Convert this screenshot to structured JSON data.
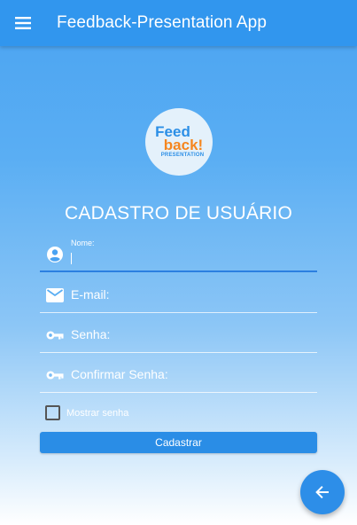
{
  "app_bar": {
    "title": "Feedback-Presentation App",
    "menu_icon": "hamburger-menu-icon"
  },
  "logo": {
    "line1": "Feed",
    "line2": "back!",
    "line3": "PRESENTATION"
  },
  "form": {
    "title": "CADASTRO DE USUÁRIO",
    "fields": [
      {
        "label": "Nome:",
        "icon": "account-circle-icon",
        "active": true
      },
      {
        "label": "E-mail:",
        "icon": "mail-icon"
      },
      {
        "label": "Senha:",
        "icon": "key-icon"
      },
      {
        "label": "Confirmar Senha:",
        "icon": "key-icon"
      }
    ],
    "show_password_label": "Mostrar senha",
    "show_password_checked": false,
    "submit_label": "Cadastrar"
  },
  "fab": {
    "icon": "arrow-back-icon"
  },
  "colors": {
    "primary": "#3196ee",
    "button": "#2a8de6",
    "active_underline": "#2b7fe0"
  }
}
